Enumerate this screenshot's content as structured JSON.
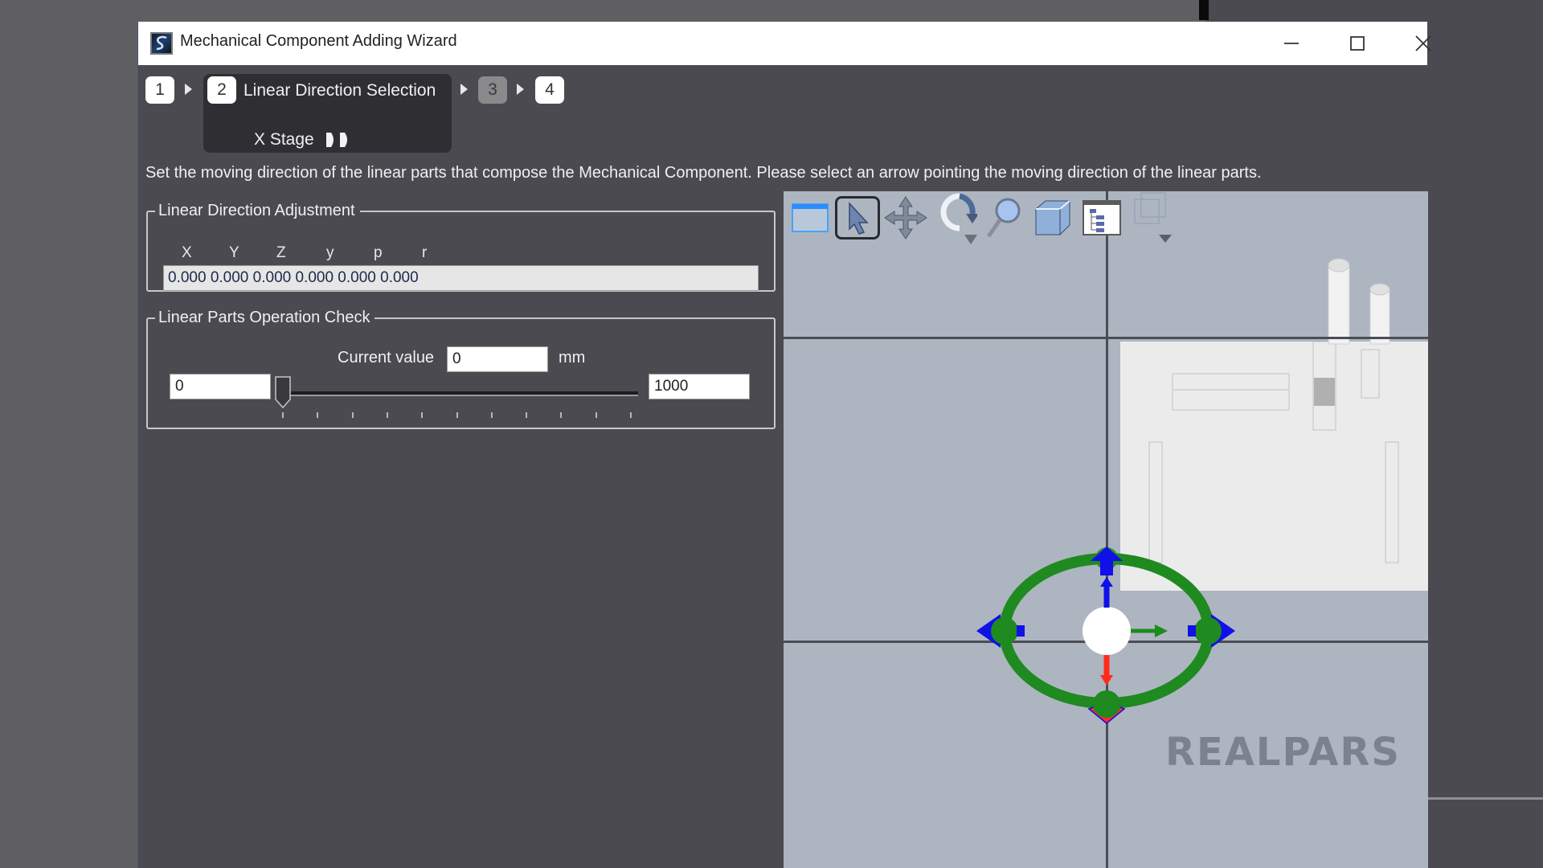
{
  "window": {
    "title": "Mechanical Component Adding Wizard",
    "icon": "app-logo-icon",
    "controls": [
      {
        "name": "minimize",
        "icon": "minimize-icon"
      },
      {
        "name": "maximize",
        "icon": "maximize-icon"
      },
      {
        "name": "close",
        "icon": "close-icon"
      }
    ]
  },
  "steps": [
    {
      "number": "1",
      "state": "done"
    },
    {
      "number": "2",
      "state": "active",
      "label": "Linear Direction Selection",
      "sub_label": "X Stage",
      "sub_icon": "play-next-icon"
    },
    {
      "number": "3",
      "state": "disabled"
    },
    {
      "number": "4",
      "state": "enabled"
    }
  ],
  "instruction": "Set the moving direction of the linear parts that compose the Mechanical Component. Please select an arrow pointing the moving direction of the linear parts.",
  "direction_adjustment": {
    "legend": "Linear Direction Adjustment",
    "axes": [
      "X",
      "Y",
      "Z",
      "y",
      "p",
      "r"
    ],
    "value": "0.000 0.000 0.000 0.000 0.000 0.000"
  },
  "operation_check": {
    "legend": "Linear Parts Operation Check",
    "current_value_label": "Current value",
    "current_value": "0",
    "unit": "mm",
    "min_value": "0",
    "max_value": "1000",
    "slider_fraction": 0.0,
    "tick_count": 11
  },
  "viewport": {
    "toolbar": [
      {
        "name": "window-view",
        "icon": "window-icon"
      },
      {
        "name": "select",
        "icon": "cursor-arrow-icon",
        "selected": true
      },
      {
        "name": "pan",
        "icon": "move-arrows-icon"
      },
      {
        "name": "rotate",
        "icon": "rotate-icon"
      },
      {
        "name": "zoom",
        "icon": "magnifier-icon"
      },
      {
        "name": "3d-view",
        "icon": "cube-icon"
      },
      {
        "name": "tree",
        "icon": "tree-list-icon"
      },
      {
        "name": "fit",
        "icon": "bounding-box-icon"
      }
    ],
    "gizmo_colors": {
      "ring": "#1f8a1f",
      "x_arrow": "#1f8a1f",
      "y_arrow": "#1010e8",
      "z_arrow": "#ff2a1a"
    },
    "background": "#adb5c1"
  },
  "watermark": "REALPARS"
}
